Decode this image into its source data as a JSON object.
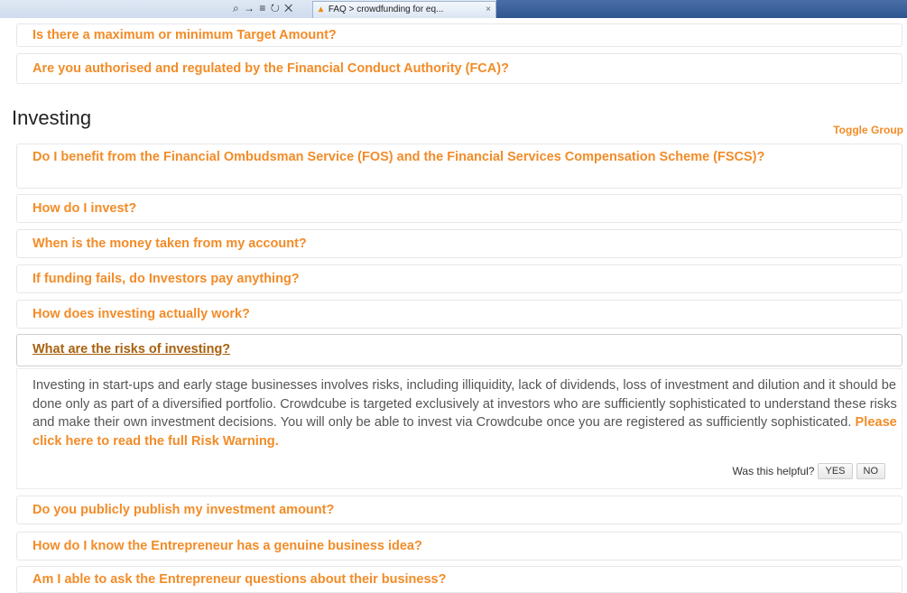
{
  "browser": {
    "nav_icons": "⌕ → ≡ ↻ ✕",
    "tab_title": "FAQ > crowdfunding for eq...",
    "tab_close": "×"
  },
  "top_questions": [
    "Is there a maximum or minimum Target Amount?",
    "Are you authorised and regulated by the Financial Conduct Authority (FCA)?"
  ],
  "section": {
    "title": "Investing",
    "toggle_label": "Toggle Group"
  },
  "questions": [
    "Do I benefit from the Financial Ombudsman Service (FOS) and the Financial Services Compensation Scheme (FSCS)?",
    "How do I invest?",
    "When is the money taken from my account?",
    "If funding fails, do Investors pay anything?",
    "How does investing actually work?",
    "What are the risks of investing?"
  ],
  "answer": {
    "text": "Investing in start-ups and early stage businesses involves risks, including illiquidity, lack of dividends, loss of investment and dilution and it should be done only as part of a diversified portfolio. Crowdcube is targeted exclusively at investors who are sufficiently sophisticated to understand these risks and make their own investment decisions. You will only be able to invest via Crowdcube once you are registered as sufficiently sophisticated. ",
    "link": "Please click here to read the full Risk Warning.",
    "helpful_label": "Was this helpful?",
    "yes": "YES",
    "no": "NO"
  },
  "more_questions": [
    "Do you publicly publish my investment amount?",
    "How do I know the Entrepreneur has a genuine business idea?",
    "Am I able to ask the Entrepreneur questions about their business?"
  ]
}
